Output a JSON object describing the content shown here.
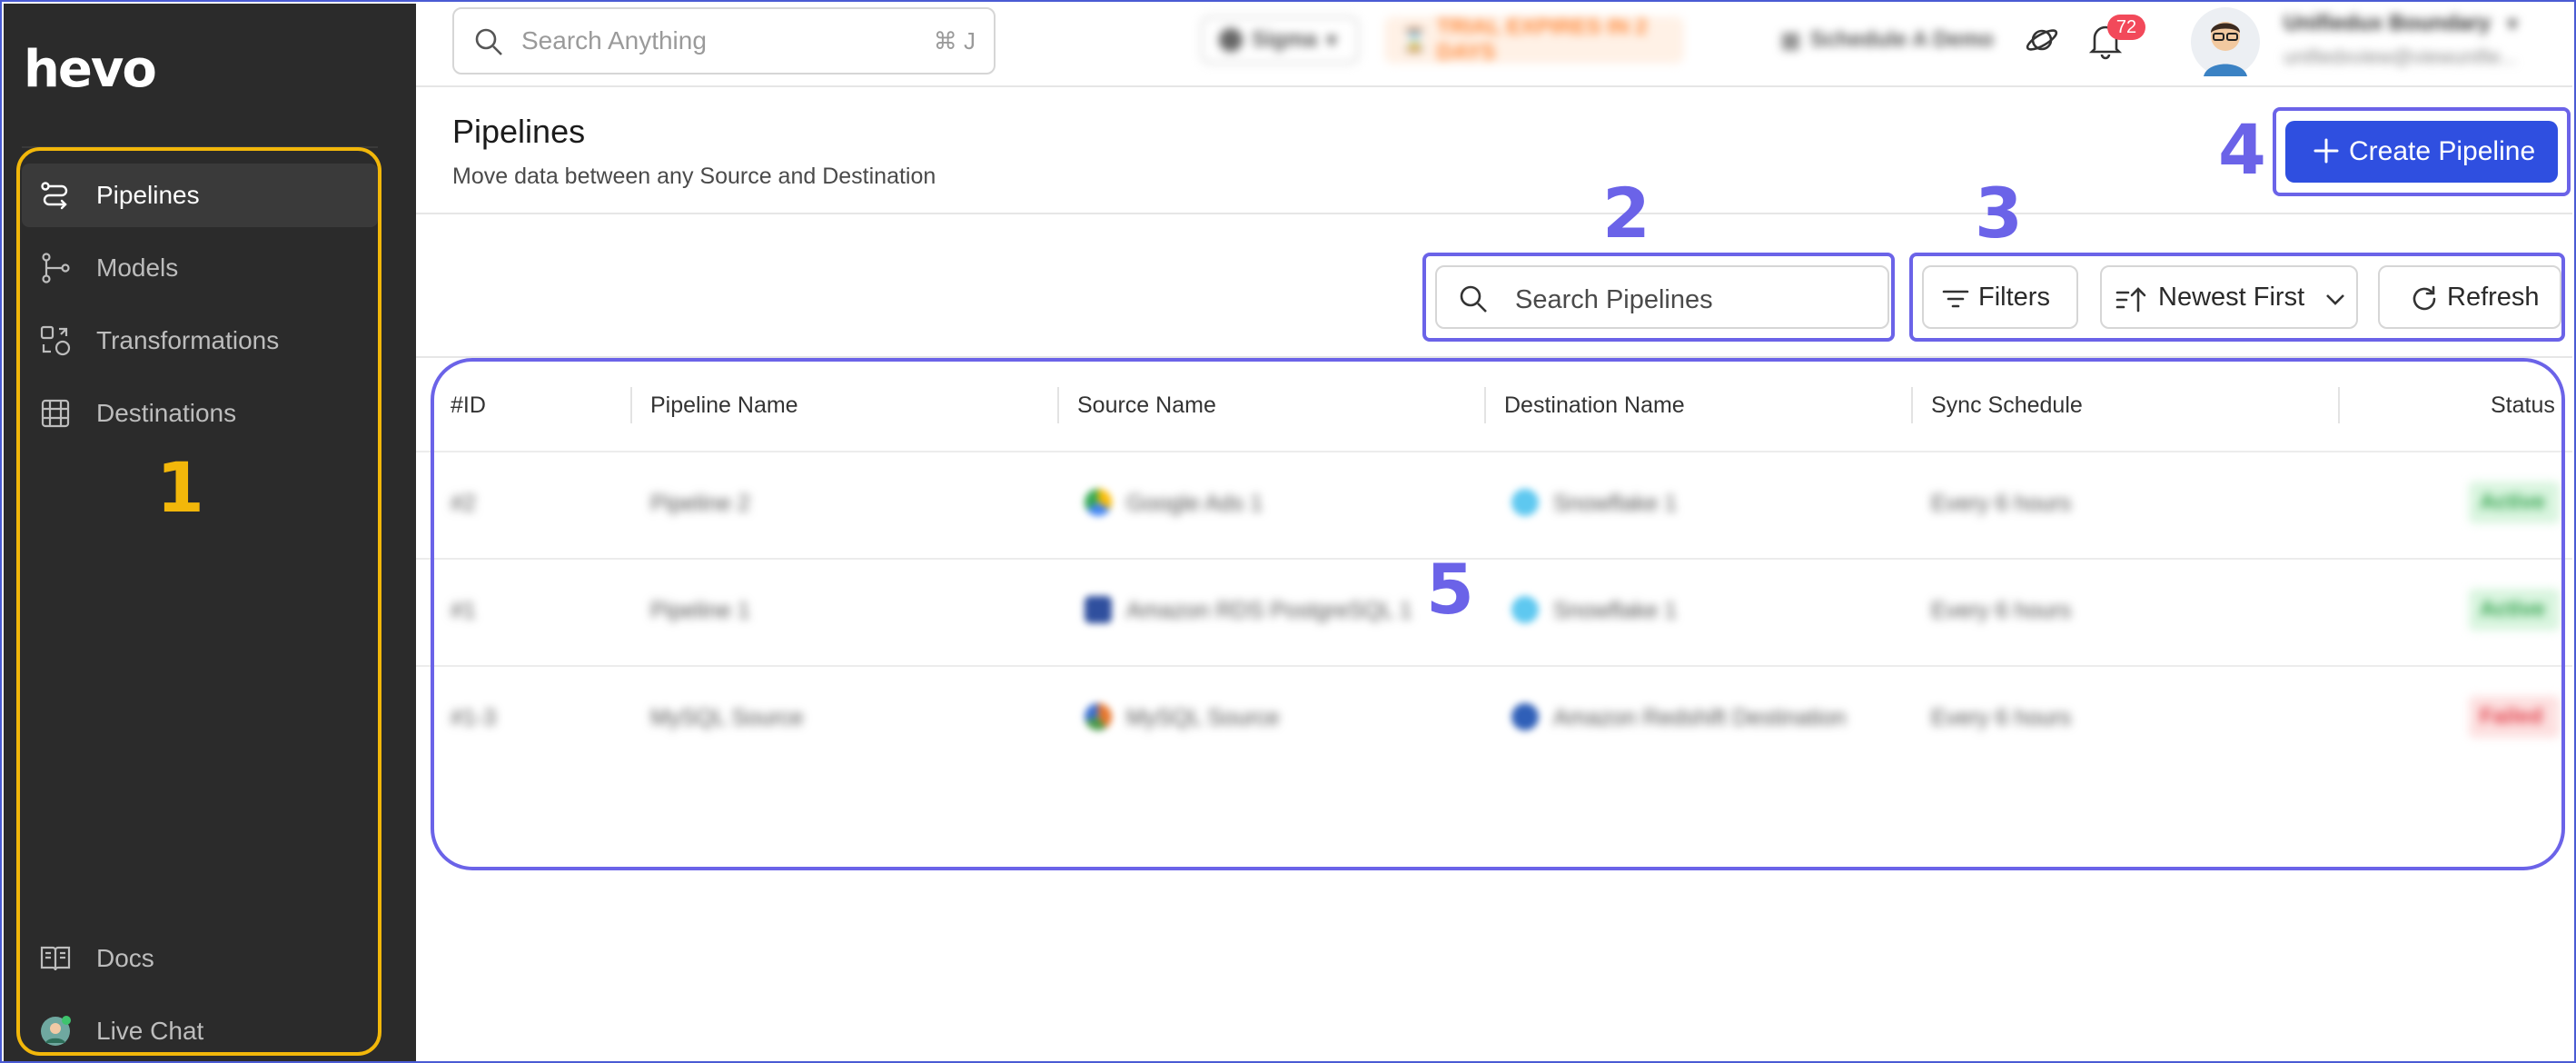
{
  "app": {
    "logo": "hevo"
  },
  "sidebar": {
    "items": [
      {
        "label": "Pipelines",
        "active": true,
        "icon": "pipelines-icon"
      },
      {
        "label": "Models",
        "active": false,
        "icon": "models-icon"
      },
      {
        "label": "Transformations",
        "active": false,
        "icon": "transformations-icon"
      },
      {
        "label": "Destinations",
        "active": false,
        "icon": "destinations-icon"
      }
    ],
    "footer": [
      {
        "label": "Docs",
        "icon": "docs-icon"
      },
      {
        "label": "Live Chat",
        "icon": "live-chat-avatar"
      }
    ]
  },
  "topbar": {
    "search_placeholder": "Search Anything",
    "search_shortcut": "⌘ J",
    "workspace": "Sigma",
    "trial_notice": "TRIAL EXPIRES IN 2 DAYS",
    "schedule_demo": "Schedule A Demo",
    "notifications_count": "72",
    "user_name": "Unifiedux Boundary",
    "user_email": "unifiedxview@viewunifie..."
  },
  "page": {
    "title": "Pipelines",
    "subtitle": "Move data between any Source and Destination",
    "create_button": "Create Pipeline"
  },
  "toolbar": {
    "search_placeholder": "Search Pipelines",
    "filters_label": "Filters",
    "sort_label": "Newest First",
    "refresh_label": "Refresh"
  },
  "table": {
    "columns": [
      "#ID",
      "Pipeline Name",
      "Source Name",
      "Destination Name",
      "Sync Schedule",
      "Status"
    ],
    "rows": [
      {
        "id": "#2",
        "name": "Pipeline 2",
        "source": "Google Ads 1",
        "destination": "Snowflake 1",
        "schedule": "Every 6 hours",
        "status": "Active"
      },
      {
        "id": "#1",
        "name": "Pipeline 1",
        "source": "Amazon RDS PostgreSQL 1",
        "destination": "Snowflake 1",
        "schedule": "Every 6 hours",
        "status": "Active"
      },
      {
        "id": "#1-3",
        "name": "MySQL Source",
        "source": "MySQL Source",
        "destination": "Amazon Redshift Destination",
        "schedule": "Every 6 hours",
        "status": "Failed"
      }
    ]
  },
  "annotations": {
    "sidebar": "1",
    "search": "2",
    "filters": "3",
    "create": "4",
    "table": "5"
  },
  "colors": {
    "sidebar_bg": "#2b2b2b",
    "accent": "#2f4fe0",
    "annotation_purple": "#6b63e8",
    "annotation_yellow": "#f2b70a"
  }
}
